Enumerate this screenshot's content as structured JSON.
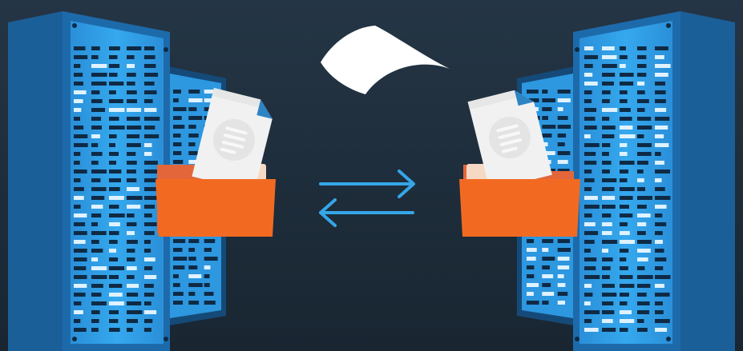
{
  "scene": {
    "background_top": "#243545",
    "background_bottom": "#192632",
    "server_frame": "#1b5f99",
    "server_frame_dark": "#154a78",
    "server_panel": "#2c9ee8",
    "server_slot": "#0f2a44",
    "led_color": "#dff2ff",
    "folder_back": "#e2663a",
    "folder_front": "#f26a22",
    "document_color": "#f1f1f1",
    "document_fold": "#2d84c4",
    "arrow_color": "#35a6e8",
    "paper_color": "#ffffff"
  },
  "icons": {
    "server_left": "server-rack-icon",
    "server_right": "server-rack-icon",
    "folder_left": "folder-icon",
    "folder_right": "folder-icon",
    "document_left": "document-icon",
    "document_right": "document-icon",
    "transfer_arrows": "bidirectional-arrows-icon",
    "flying_paper": "paper-icon"
  }
}
